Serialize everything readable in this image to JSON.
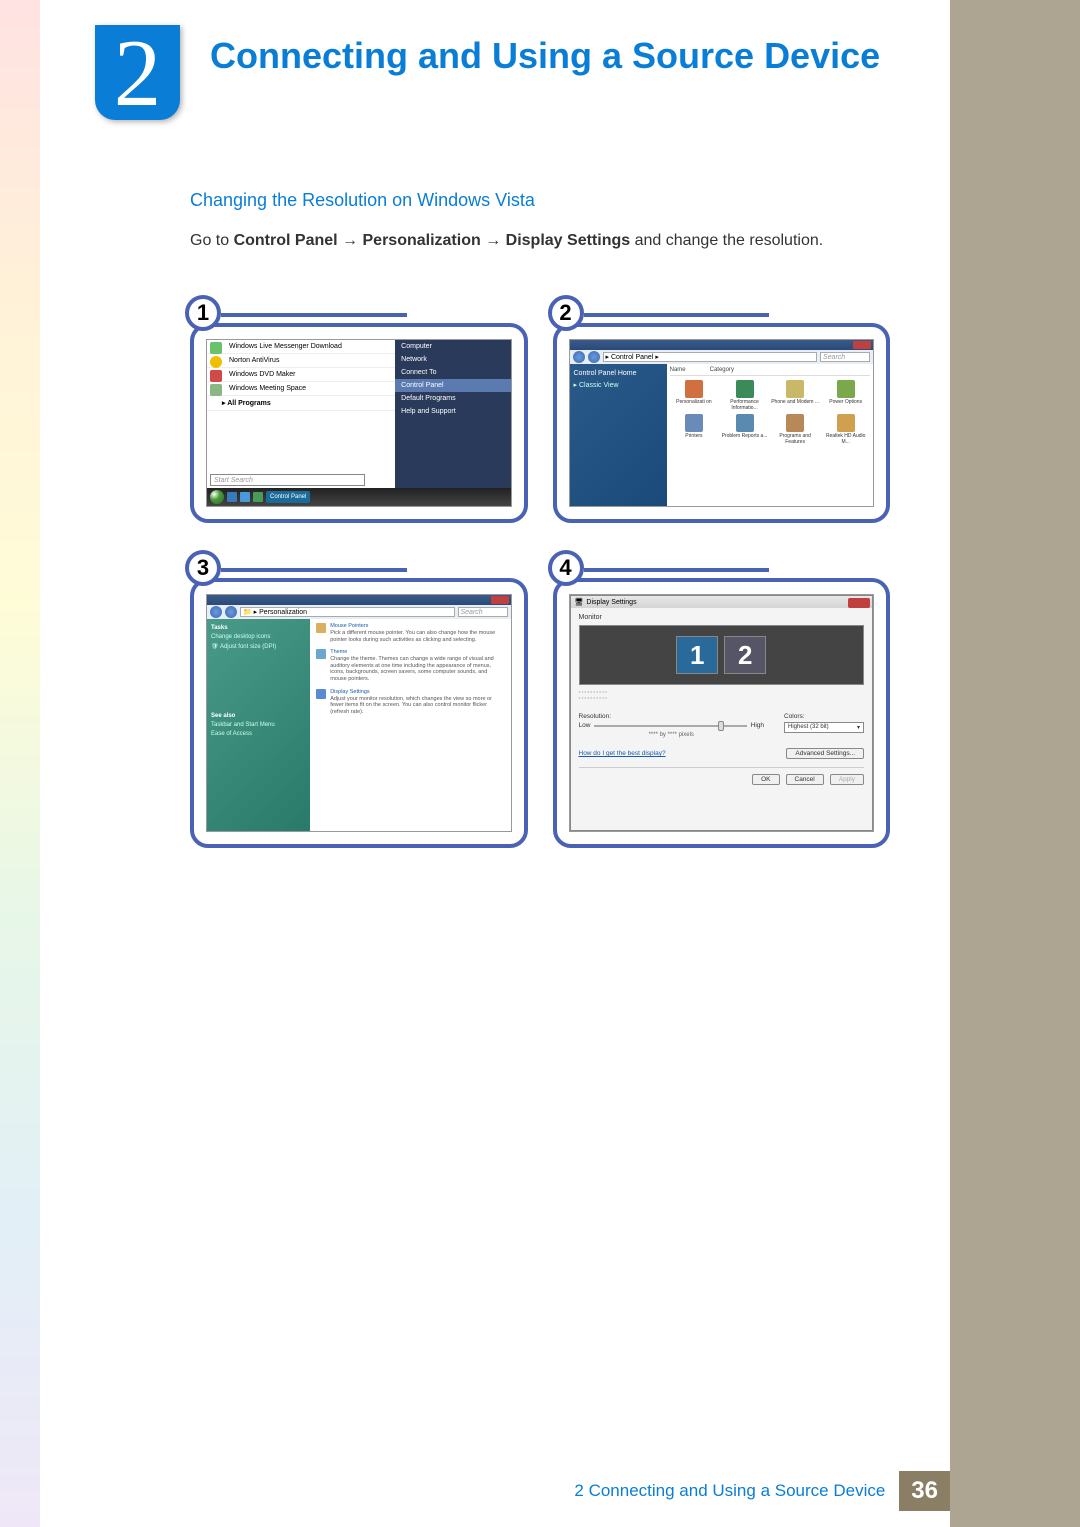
{
  "chapter": {
    "number": "2",
    "title": "Connecting and Using a Source Device"
  },
  "content": {
    "subheading": "Changing the Resolution on Windows Vista",
    "instruction_prefix": "Go to ",
    "path1": "Control Panel",
    "path2": "Personalization",
    "path3": "Display Settings",
    "instruction_suffix": " and change the resolution."
  },
  "step_badges": [
    "1",
    "2",
    "3",
    "4"
  ],
  "screenshot1": {
    "start_items": [
      {
        "label": "Windows Live Messenger Download",
        "color": "#6ac26a"
      },
      {
        "label": "Norton AntiVirus",
        "color": "#f0c000"
      },
      {
        "label": "Windows DVD Maker",
        "color": "#d04a4a"
      },
      {
        "label": "Windows Meeting Space",
        "color": "#8ab884"
      },
      {
        "label": "All Programs",
        "color": "#000",
        "bold": true
      }
    ],
    "start_right": [
      "Computer",
      "Network",
      "Connect To",
      "Control Panel",
      "Default Programs",
      "Help and Support"
    ],
    "highlight": "Control Panel",
    "search_placeholder": "Start Search",
    "taskbar_label": "Control Panel"
  },
  "screenshot2": {
    "breadcrumb": "▸ Control Panel ▸",
    "search": "Search",
    "sidebar": [
      "Control Panel Home",
      "Classic View"
    ],
    "headers": [
      "Name",
      "Category"
    ],
    "icons": [
      {
        "label": "Personalizati on",
        "color": "#d07040"
      },
      {
        "label": "Performance Informatio...",
        "color": "#3a8a5a"
      },
      {
        "label": "Phone and Modem ...",
        "color": "#c8b868"
      },
      {
        "label": "Power Options",
        "color": "#7aa84a"
      },
      {
        "label": "Printers",
        "color": "#6a8aba"
      },
      {
        "label": "Problem Reports a...",
        "color": "#5a8ab0"
      },
      {
        "label": "Programs and Features",
        "color": "#b88858"
      },
      {
        "label": "Realtek HD Audio M...",
        "color": "#d0a050"
      }
    ]
  },
  "screenshot3": {
    "breadcrumb": "▸ Personalization",
    "search": "Search",
    "tasks_header": "Tasks",
    "tasks": [
      "Change desktop icons",
      "Adjust font size (DPI)"
    ],
    "see_also": "See also",
    "see_also_items": [
      "Taskbar and Start Menu",
      "Ease of Access"
    ],
    "sections": [
      {
        "title": "Mouse Pointers",
        "desc": "Pick a different mouse pointer. You can also change how the mouse pointer looks during such activities as clicking and selecting.",
        "color": "#d8b060"
      },
      {
        "title": "Theme",
        "desc": "Change the theme. Themes can change a wide range of visual and auditory elements at one time including the appearance of menus, icons, backgrounds, screen savers, some computer sounds, and mouse pointers.",
        "color": "#6aa8d0"
      },
      {
        "title": "Display Settings",
        "desc": "Adjust your monitor resolution, which changes the view so more or fewer items fit on the screen. You can also control monitor flicker (refresh rate).",
        "color": "#5a8ad0"
      }
    ]
  },
  "screenshot4": {
    "window_title": "Display Settings",
    "monitor_tab": "Monitor",
    "mon1": "1",
    "mon2": "2",
    "placeholder": "**********",
    "resolution_label": "Resolution:",
    "low": "Low",
    "high": "High",
    "pixels": "**** by **** pixels",
    "colors_label": "Colors:",
    "colors_value": "Highest (32 bit)",
    "help_link": "How do I get the best display?",
    "advanced": "Advanced Settings...",
    "ok": "OK",
    "cancel": "Cancel",
    "apply": "Apply"
  },
  "footer": {
    "text": "2 Connecting and Using a Source Device",
    "page": "36"
  }
}
